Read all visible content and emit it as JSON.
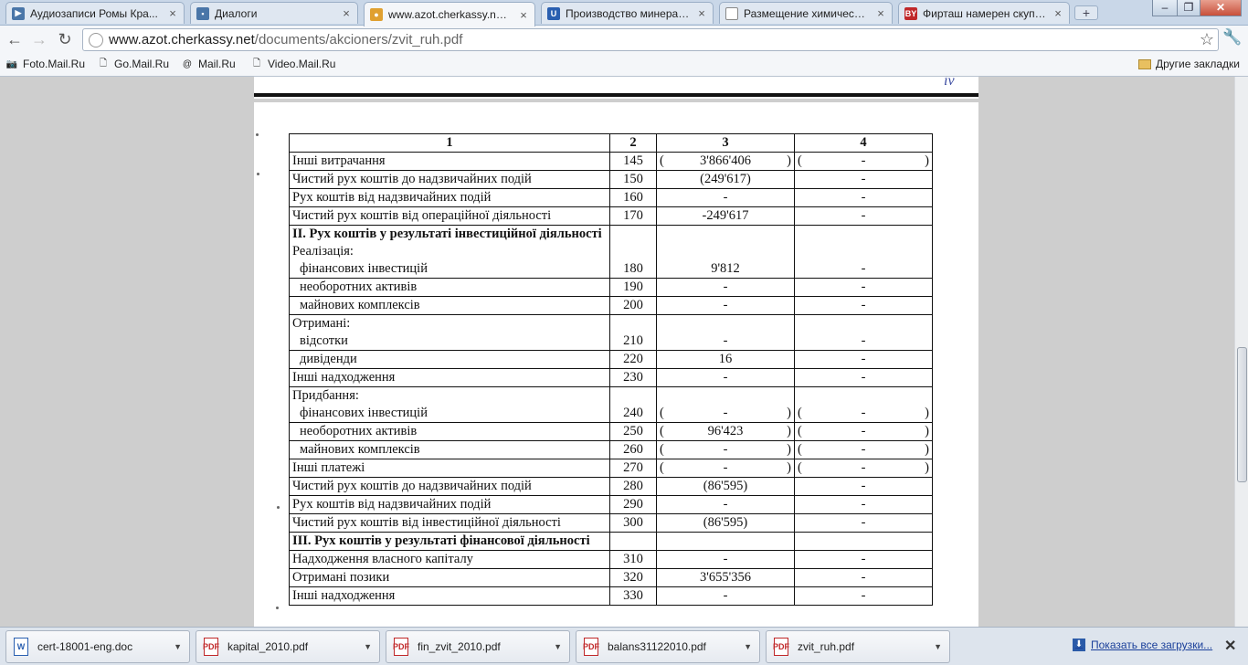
{
  "tabs": [
    {
      "title": "Аудиозаписи Ромы Кра...",
      "icon": "vk-play-icon",
      "color": "#4a76a8",
      "glyph": "▶"
    },
    {
      "title": "Диалоги",
      "icon": "vk-chat-icon",
      "color": "#4a76a8",
      "glyph": "▪"
    },
    {
      "title": "www.azot.cherkassy.net/...",
      "icon": "chrome-page-icon",
      "color": "#e0a030",
      "glyph": "●"
    },
    {
      "title": "Производство минерал...",
      "icon": "ua-flag-icon",
      "color": "#2a5fb0",
      "glyph": "U"
    },
    {
      "title": "Размещение химическо...",
      "icon": "blank-page-icon",
      "color": "#ffffff",
      "glyph": ""
    },
    {
      "title": "Фирташ намерен скупи...",
      "icon": "bu-logo-icon",
      "color": "#c0282a",
      "glyph": "BY"
    }
  ],
  "address": {
    "host": "www.azot.cherkassy.net",
    "path": "/documents/akcioners/zvit_ruh.pdf"
  },
  "bookmarks": [
    {
      "label": "Foto.Mail.Ru",
      "icon": "camera-icon",
      "glyph": "📷"
    },
    {
      "label": "Go.Mail.Ru",
      "icon": "page-icon",
      "glyph": "🗋"
    },
    {
      "label": "Mail.Ru",
      "icon": "mailru-at-icon",
      "glyph": "@"
    },
    {
      "label": "Video.Mail.Ru",
      "icon": "page-icon",
      "glyph": "🗋"
    }
  ],
  "other_bookmarks": "Другие закладки",
  "prev_page_mark": "iv",
  "table": {
    "header": [
      "1",
      "2",
      "3",
      "4"
    ],
    "rows": [
      {
        "label": "Інші витрачання",
        "code": "145",
        "v3": "3'866'406",
        "v4": "-",
        "paren": true
      },
      {
        "label": "Чистий рух коштів до надзвичайних подій",
        "code": "150",
        "v3": "(249'617)",
        "v4": "-"
      },
      {
        "label": "Рух коштів від надзвичайних подій",
        "code": "160",
        "v3": "-",
        "v4": "-"
      },
      {
        "label": "Чистий рух коштів від операційної діяльності",
        "code": "170",
        "v3": "-249'617",
        "v4": "-"
      },
      {
        "section": "ІІ. Рух коштів у результаті інвестиційної діяльності",
        "sub": "Реалізація:",
        "label": "фінансових інвестицій",
        "indent": true,
        "code": "180",
        "v3": "9'812",
        "v4": "-"
      },
      {
        "label": "необоротних активів",
        "indent": true,
        "code": "190",
        "v3": "-",
        "v4": "-"
      },
      {
        "label": "майнових комплексів",
        "indent": true,
        "code": "200",
        "v3": "-",
        "v4": "-"
      },
      {
        "sub": "Отримані:",
        "label": "відсотки",
        "indent": true,
        "code": "210",
        "v3": "-",
        "v4": "-"
      },
      {
        "label": "дивіденди",
        "indent": true,
        "code": "220",
        "v3": "16",
        "v4": "-"
      },
      {
        "label": "Інші надходження",
        "code": "230",
        "v3": "-",
        "v4": "-"
      },
      {
        "sub": "Придбання:",
        "label": "фінансових інвестицій",
        "indent": true,
        "code": "240",
        "v3": "-",
        "v4": "-",
        "paren": true
      },
      {
        "label": "необоротних активів",
        "indent": true,
        "code": "250",
        "v3": "96'423",
        "v4": "-",
        "paren": true
      },
      {
        "label": "майнових комплексів",
        "indent": true,
        "code": "260",
        "v3": "-",
        "v4": "-",
        "paren": true
      },
      {
        "label": "Інші платежі",
        "code": "270",
        "v3": "-",
        "v4": "-",
        "paren": true
      },
      {
        "label": "Чистий рух коштів до надзвичайних подій",
        "code": "280",
        "v3": "(86'595)",
        "v4": "-"
      },
      {
        "label": "Рух коштів від надзвичайних подій",
        "code": "290",
        "v3": "-",
        "v4": "-"
      },
      {
        "label": "Чистий рух коштів від інвестиційної діяльності",
        "code": "300",
        "v3": "(86'595)",
        "v4": "-"
      },
      {
        "section": "ІІІ. Рух коштів у результаті фінансової діяльності",
        "sectionOnly": true
      },
      {
        "label": "Надходження власного капіталу",
        "code": "310",
        "v3": "-",
        "v4": "-"
      },
      {
        "label": "Отримані позики",
        "code": "320",
        "v3": "3'655'356",
        "v4": "-"
      },
      {
        "label": "Інші надходження",
        "code": "330",
        "v3": "-",
        "v4": "-"
      }
    ]
  },
  "downloads": [
    {
      "name": "cert-18001-eng.doc",
      "type": "doc",
      "icon": "word-doc-icon"
    },
    {
      "name": "kapital_2010.pdf",
      "type": "pdf",
      "icon": "pdf-file-icon"
    },
    {
      "name": "fin_zvit_2010.pdf",
      "type": "pdf",
      "icon": "pdf-file-icon"
    },
    {
      "name": "balans31122010.pdf",
      "type": "pdf",
      "icon": "pdf-file-icon"
    },
    {
      "name": "zvit_ruh.pdf",
      "type": "pdf",
      "icon": "pdf-file-icon"
    }
  ],
  "show_all_downloads": "Показать все загрузки..."
}
